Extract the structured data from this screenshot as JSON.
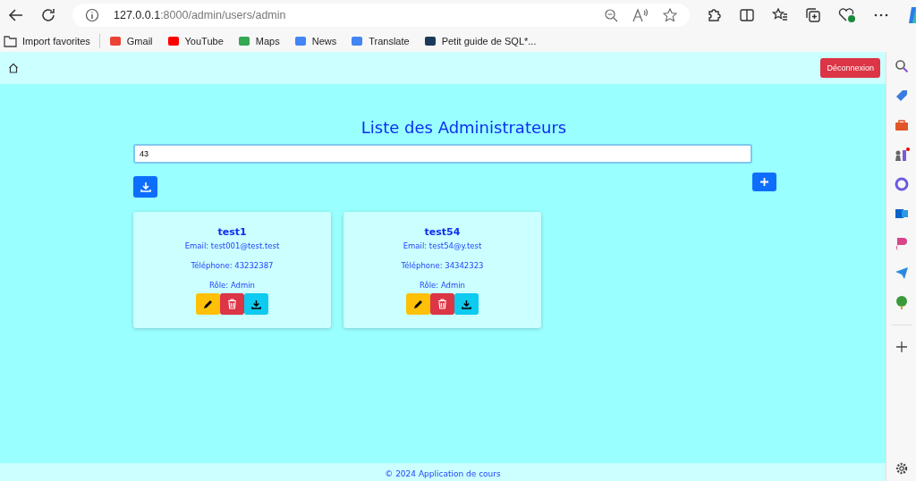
{
  "browser": {
    "url_host": "127.0.0.1",
    "url_path": ":8000/admin/users/admin",
    "bookmarks": [
      {
        "label": "Import favorites",
        "kind": "import"
      },
      {
        "label": "Gmail",
        "kind": "gmail"
      },
      {
        "label": "YouTube",
        "kind": "youtube"
      },
      {
        "label": "Maps",
        "kind": "maps"
      },
      {
        "label": "News",
        "kind": "news"
      },
      {
        "label": "Translate",
        "kind": "translate"
      },
      {
        "label": "Petit guide de SQL*...",
        "kind": "guide"
      }
    ]
  },
  "navbar": {
    "logout": "Déconnexion"
  },
  "title": "Liste des Administrateurs",
  "search": {
    "value": "43"
  },
  "admins": [
    {
      "name": "test1",
      "email": "Email: test001@test.test",
      "phone": "Téléphone: 43232387",
      "role": "Rôle: Admin"
    },
    {
      "name": "test54",
      "email": "Email: test54@y.test",
      "phone": "Téléphone: 34342323",
      "role": "Rôle: Admin"
    }
  ],
  "footer": "© 2024 Application de cours"
}
